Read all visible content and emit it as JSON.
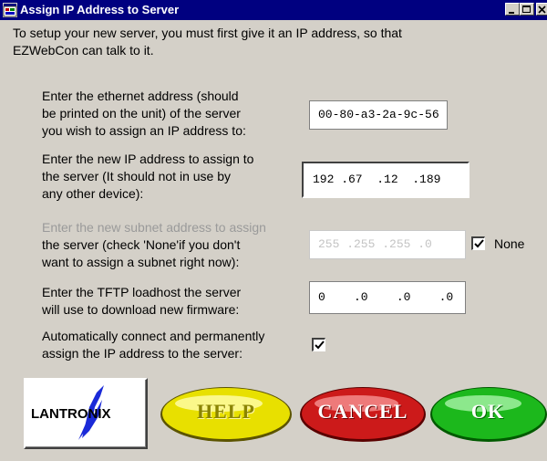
{
  "window": {
    "title": "Assign IP Address to Server",
    "icon": "app-window-icon",
    "controls": [
      "minimize-icon",
      "maximize-icon",
      "close-icon"
    ]
  },
  "intro": {
    "line1": "To setup your new server, you must first give it an IP address, so that",
    "line2": "EZWebCon can talk to it."
  },
  "ethernet": {
    "label_lines": [
      "Enter the ethernet address (should",
      "be printed on the unit) of the server",
      "you wish to assign an IP address to:"
    ],
    "value": "00-80-a3-2a-9c-56"
  },
  "ip": {
    "label_lines": [
      "Enter the new IP address to assign to",
      "the server (It should not in use by",
      "any other device):"
    ],
    "value": "192 .67  .12  .189"
  },
  "subnet": {
    "label_lines": [
      "Enter the new subnet address to assign",
      "the server (check 'None'if you don't",
      "want to assign a subnet right now):"
    ],
    "value": "255 .255 .255 .0",
    "none_label": "None",
    "none_checked": true
  },
  "tftp": {
    "label_lines": [
      "Enter the TFTP loadhost the server",
      "will use to download new firmware:"
    ],
    "value": "0    .0    .0    .0"
  },
  "auto": {
    "label_lines": [
      "Automatically connect and permanently",
      "assign the IP address to the server:"
    ],
    "checked": true
  },
  "buttons": {
    "logo_text": "LANTRONIX",
    "help": "HELP",
    "cancel": "CANCEL",
    "ok": "OK"
  },
  "colors": {
    "titlebar": "#000080",
    "help": "#e8e000",
    "cancel": "#cc1a1a",
    "ok": "#1cb81c"
  }
}
